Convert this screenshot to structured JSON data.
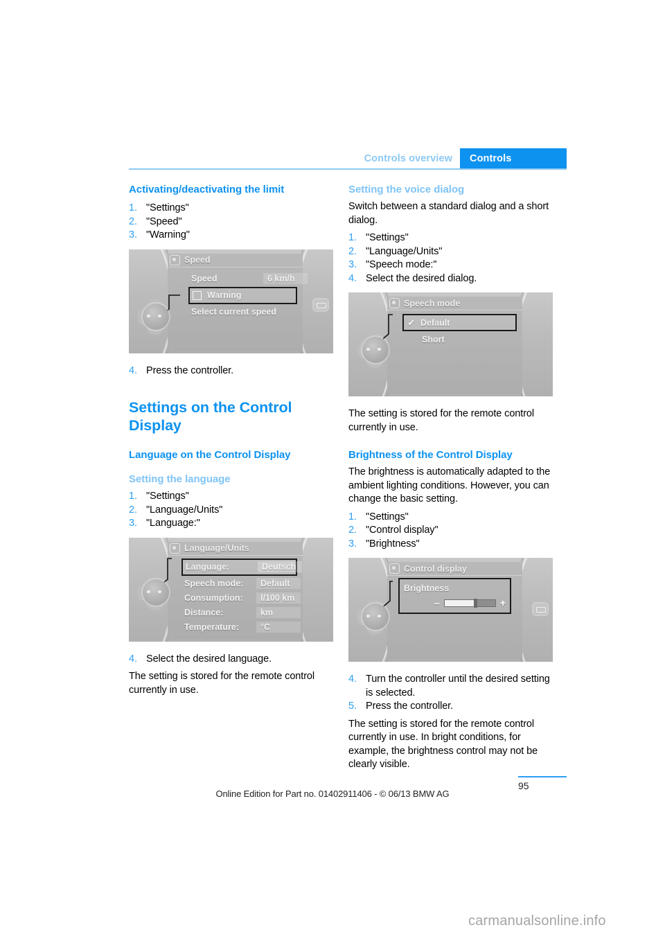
{
  "header": {
    "tab_inactive": "Controls overview",
    "tab_active": "Controls",
    "accent_blue": "#0d92f0",
    "accent_light_blue": "#8cc9f2"
  },
  "left_column": {
    "heading_limit": "Activating/deactivating the limit",
    "limit_steps": [
      {
        "num": "1.",
        "text": "\"Settings\""
      },
      {
        "num": "2.",
        "text": "\"Speed\""
      },
      {
        "num": "3.",
        "text": "\"Warning\""
      }
    ],
    "figure_speed": {
      "title": "Speed",
      "title_icon": "gear-icon",
      "rows": [
        {
          "label": "Speed",
          "value": "6 km/h"
        }
      ],
      "checkbox_row": "Warning",
      "hint": "Select current speed"
    },
    "after_figure_step": {
      "num": "4.",
      "text": "Press the controller."
    },
    "heading_settings": "Settings on the Control Display",
    "heading_language": "Language on the Control Display",
    "subheading_setting_language": "Setting the language",
    "language_steps": [
      {
        "num": "1.",
        "text": "\"Settings\""
      },
      {
        "num": "2.",
        "text": "\"Language/Units\""
      },
      {
        "num": "3.",
        "text": "\"Language:\""
      }
    ],
    "figure_language": {
      "title": "Language/Units",
      "title_icon": "gear-icon",
      "rows": [
        {
          "label": "Language:",
          "value": "Deutsch",
          "highlight": true
        },
        {
          "label": "Speech mode:",
          "value": "Default",
          "highlight": false
        },
        {
          "label": "Consumption:",
          "value": "l/100 km",
          "highlight": false
        },
        {
          "label": "Distance:",
          "value": "km",
          "highlight": false
        },
        {
          "label": "Temperature:",
          "value": "°C",
          "highlight": false
        }
      ]
    },
    "final_step": {
      "num": "4.",
      "text": "Select the desired language."
    },
    "final_note": "The setting is stored for the remote control currently in use."
  },
  "right_column": {
    "subheading_voice": "Setting the voice dialog",
    "voice_intro": "Switch between a standard dialog and a short dialog.",
    "voice_steps": [
      {
        "num": "1.",
        "text": "\"Settings\""
      },
      {
        "num": "2.",
        "text": "\"Language/Units\""
      },
      {
        "num": "3.",
        "text": "\"Speech mode:\""
      },
      {
        "num": "4.",
        "text": "Select the desired dialog."
      }
    ],
    "figure_speech": {
      "title": "Speech mode",
      "title_icon": "gear-icon",
      "checked_item": "Default",
      "checked_glyph": "✓",
      "unchecked_item": "Short"
    },
    "voice_note": "The setting is stored for the remote control currently in use.",
    "heading_brightness": "Brightness of the Control Display",
    "brightness_intro": "The brightness is automatically adapted to the ambient lighting conditions. However, you can change the basic setting.",
    "brightness_steps": [
      {
        "num": "1.",
        "text": "\"Settings\""
      },
      {
        "num": "2.",
        "text": "\"Control display\""
      },
      {
        "num": "3.",
        "text": "\"Brightness\""
      }
    ],
    "figure_control_display": {
      "title": "Control display",
      "title_icon": "gear-icon",
      "slider_label": "Brightness",
      "minus": "–",
      "plus": "+",
      "fill_percent": 58
    },
    "brightness_steps_2": [
      {
        "num": "4.",
        "text": "Turn the controller until the desired setting is selected."
      },
      {
        "num": "5.",
        "text": "Press the controller."
      }
    ],
    "brightness_note": "The setting is stored for the remote control currently in use. In bright conditions, for example, the brightness control may not be clearly visible."
  },
  "footer": {
    "note": "Online Edition for Part no. 01402911406 - © 06/13 BMW AG",
    "page_number": "95",
    "watermark": "carmanualsonline.info"
  }
}
